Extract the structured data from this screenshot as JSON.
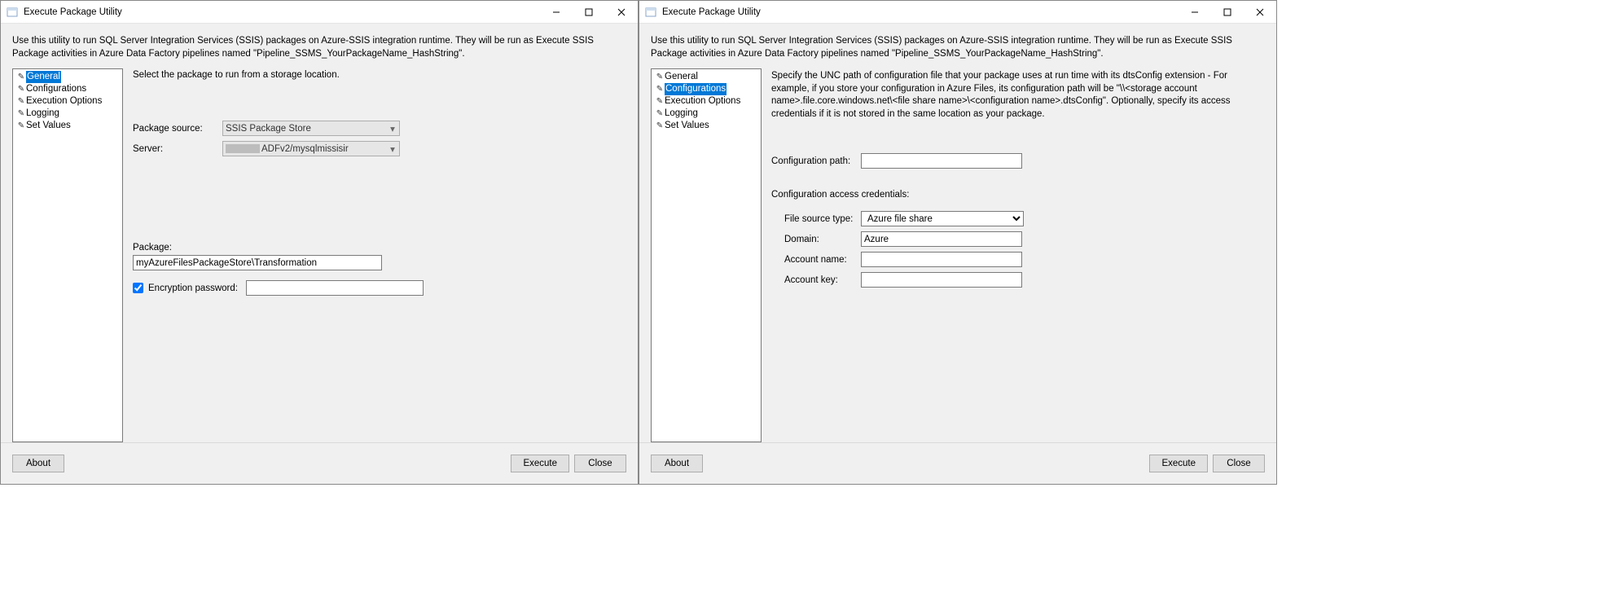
{
  "window_title": "Execute Package Utility",
  "intro_text": "Use this utility to run SQL Server Integration Services (SSIS) packages on Azure-SSIS integration runtime. They will be run as Execute SSIS Package activities in Azure Data Factory pipelines named \"Pipeline_SSMS_YourPackageName_HashString\".",
  "nav": {
    "items": [
      "General",
      "Configurations",
      "Execution Options",
      "Logging",
      "Set Values"
    ]
  },
  "left": {
    "heading": "Select the package to run from a storage location.",
    "package_source_label": "Package source:",
    "package_source_value": "SSIS Package Store",
    "server_label": "Server:",
    "server_value": "ADFv2/mysqlmissisir",
    "package_label": "Package:",
    "package_value": "myAzureFilesPackageStore\\Transformation",
    "encryption_checkbox_label": "Encryption password:"
  },
  "right": {
    "heading": "Specify the UNC path of configuration file that your package uses at run time with its dtsConfig extension - For example, if you store your configuration in Azure Files, its configuration path will be \"\\\\<storage account name>.file.core.windows.net\\<file share name>\\<configuration name>.dtsConfig\".  Optionally, specify its access credentials if it is not stored in the same location as your package.",
    "config_path_label": "Configuration path:",
    "subheading": "Configuration access credentials:",
    "file_source_type_label": "File source type:",
    "file_source_type_value": "Azure file share",
    "domain_label": "Domain:",
    "domain_value": "Azure",
    "account_name_label": "Account name:",
    "account_key_label": "Account key:"
  },
  "buttons": {
    "about": "About",
    "execute": "Execute",
    "close": "Close"
  }
}
